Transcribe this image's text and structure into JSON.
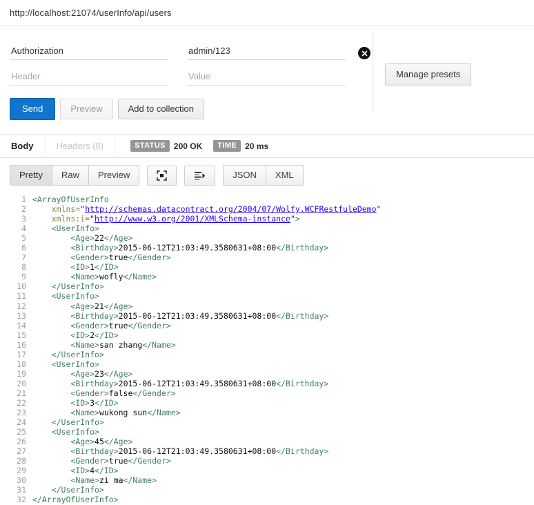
{
  "request": {
    "url": "http://localhost:21074/userInfo/api/users",
    "headers": [
      {
        "name_value": "Authorization",
        "name_placeholder": "Header",
        "value_value": "admin/123",
        "value_placeholder": "Value"
      },
      {
        "name_value": "",
        "name_placeholder": "Header",
        "value_value": "",
        "value_placeholder": "Value"
      }
    ],
    "clear_icon": "clear-circle-icon",
    "manage_presets_label": "Manage presets",
    "actions": {
      "send_label": "Send",
      "preview_label": "Preview",
      "add_to_collection_label": "Add to collection"
    }
  },
  "response": {
    "tabs": [
      {
        "label": "Body",
        "active": true
      },
      {
        "label": "Headers (8)",
        "active": false
      }
    ],
    "status_badge_label": "STATUS",
    "status_value": "200 OK",
    "time_badge_label": "TIME",
    "time_value": "20 ms",
    "view_modes": [
      {
        "label": "Pretty",
        "active": true
      },
      {
        "label": "Raw",
        "active": false
      },
      {
        "label": "Preview",
        "active": false
      }
    ],
    "icon_buttons": [
      {
        "icon": "fullscreen-icon"
      },
      {
        "icon": "format-indent-icon"
      }
    ],
    "content_types": [
      {
        "label": "JSON",
        "active": false
      },
      {
        "label": "XML",
        "active": false
      }
    ]
  },
  "code": {
    "language": "xml",
    "lines": [
      {
        "n": 1,
        "parts": [
          {
            "t": "tag",
            "s": "<ArrayOfUserInfo"
          }
        ]
      },
      {
        "n": 2,
        "parts": [
          {
            "t": "plain",
            "s": "    "
          },
          {
            "t": "attr",
            "s": "xmlns="
          },
          {
            "t": "str",
            "s": "\""
          },
          {
            "t": "lnk",
            "s": "http://schemas.datacontract.org/2004/07/Wolfy.WCFRestfuleDemo"
          },
          {
            "t": "str",
            "s": "\""
          }
        ]
      },
      {
        "n": 3,
        "parts": [
          {
            "t": "plain",
            "s": "    "
          },
          {
            "t": "attr",
            "s": "xmlns:i="
          },
          {
            "t": "str",
            "s": "\""
          },
          {
            "t": "lnk",
            "s": "http://www.w3.org/2001/XMLSchema-instance"
          },
          {
            "t": "str",
            "s": "\""
          },
          {
            "t": "tag",
            "s": ">"
          }
        ]
      },
      {
        "n": 4,
        "parts": [
          {
            "t": "plain",
            "s": "    "
          },
          {
            "t": "tag",
            "s": "<UserInfo>"
          }
        ]
      },
      {
        "n": 5,
        "parts": [
          {
            "t": "plain",
            "s": "        "
          },
          {
            "t": "tag",
            "s": "<Age>"
          },
          {
            "t": "txt",
            "s": "22"
          },
          {
            "t": "tag",
            "s": "</Age>"
          }
        ]
      },
      {
        "n": 6,
        "parts": [
          {
            "t": "plain",
            "s": "        "
          },
          {
            "t": "tag",
            "s": "<Birthday>"
          },
          {
            "t": "txt",
            "s": "2015-06-12T21:03:49.3580631+08:00"
          },
          {
            "t": "tag",
            "s": "</Birthday>"
          }
        ]
      },
      {
        "n": 7,
        "parts": [
          {
            "t": "plain",
            "s": "        "
          },
          {
            "t": "tag",
            "s": "<Gender>"
          },
          {
            "t": "txt",
            "s": "true"
          },
          {
            "t": "tag",
            "s": "</Gender>"
          }
        ]
      },
      {
        "n": 8,
        "parts": [
          {
            "t": "plain",
            "s": "        "
          },
          {
            "t": "tag",
            "s": "<ID>"
          },
          {
            "t": "txt",
            "s": "1"
          },
          {
            "t": "tag",
            "s": "</ID>"
          }
        ]
      },
      {
        "n": 9,
        "parts": [
          {
            "t": "plain",
            "s": "        "
          },
          {
            "t": "tag",
            "s": "<Name>"
          },
          {
            "t": "txt",
            "s": "wofly"
          },
          {
            "t": "tag",
            "s": "</Name>"
          }
        ]
      },
      {
        "n": 10,
        "parts": [
          {
            "t": "plain",
            "s": "    "
          },
          {
            "t": "tag",
            "s": "</UserInfo>"
          }
        ]
      },
      {
        "n": 11,
        "parts": [
          {
            "t": "plain",
            "s": "    "
          },
          {
            "t": "tag",
            "s": "<UserInfo>"
          }
        ]
      },
      {
        "n": 12,
        "parts": [
          {
            "t": "plain",
            "s": "        "
          },
          {
            "t": "tag",
            "s": "<Age>"
          },
          {
            "t": "txt",
            "s": "21"
          },
          {
            "t": "tag",
            "s": "</Age>"
          }
        ]
      },
      {
        "n": 13,
        "parts": [
          {
            "t": "plain",
            "s": "        "
          },
          {
            "t": "tag",
            "s": "<Birthday>"
          },
          {
            "t": "txt",
            "s": "2015-06-12T21:03:49.3580631+08:00"
          },
          {
            "t": "tag",
            "s": "</Birthday>"
          }
        ]
      },
      {
        "n": 14,
        "parts": [
          {
            "t": "plain",
            "s": "        "
          },
          {
            "t": "tag",
            "s": "<Gender>"
          },
          {
            "t": "txt",
            "s": "true"
          },
          {
            "t": "tag",
            "s": "</Gender>"
          }
        ]
      },
      {
        "n": 15,
        "parts": [
          {
            "t": "plain",
            "s": "        "
          },
          {
            "t": "tag",
            "s": "<ID>"
          },
          {
            "t": "txt",
            "s": "2"
          },
          {
            "t": "tag",
            "s": "</ID>"
          }
        ]
      },
      {
        "n": 16,
        "parts": [
          {
            "t": "plain",
            "s": "        "
          },
          {
            "t": "tag",
            "s": "<Name>"
          },
          {
            "t": "txt",
            "s": "san zhang"
          },
          {
            "t": "tag",
            "s": "</Name>"
          }
        ]
      },
      {
        "n": 17,
        "parts": [
          {
            "t": "plain",
            "s": "    "
          },
          {
            "t": "tag",
            "s": "</UserInfo>"
          }
        ]
      },
      {
        "n": 18,
        "parts": [
          {
            "t": "plain",
            "s": "    "
          },
          {
            "t": "tag",
            "s": "<UserInfo>"
          }
        ]
      },
      {
        "n": 19,
        "parts": [
          {
            "t": "plain",
            "s": "        "
          },
          {
            "t": "tag",
            "s": "<Age>"
          },
          {
            "t": "txt",
            "s": "23"
          },
          {
            "t": "tag",
            "s": "</Age>"
          }
        ]
      },
      {
        "n": 20,
        "parts": [
          {
            "t": "plain",
            "s": "        "
          },
          {
            "t": "tag",
            "s": "<Birthday>"
          },
          {
            "t": "txt",
            "s": "2015-06-12T21:03:49.3580631+08:00"
          },
          {
            "t": "tag",
            "s": "</Birthday>"
          }
        ]
      },
      {
        "n": 21,
        "parts": [
          {
            "t": "plain",
            "s": "        "
          },
          {
            "t": "tag",
            "s": "<Gender>"
          },
          {
            "t": "txt",
            "s": "false"
          },
          {
            "t": "tag",
            "s": "</Gender>"
          }
        ]
      },
      {
        "n": 22,
        "parts": [
          {
            "t": "plain",
            "s": "        "
          },
          {
            "t": "tag",
            "s": "<ID>"
          },
          {
            "t": "txt",
            "s": "3"
          },
          {
            "t": "tag",
            "s": "</ID>"
          }
        ]
      },
      {
        "n": 23,
        "parts": [
          {
            "t": "plain",
            "s": "        "
          },
          {
            "t": "tag",
            "s": "<Name>"
          },
          {
            "t": "txt",
            "s": "wukong sun"
          },
          {
            "t": "tag",
            "s": "</Name>"
          }
        ]
      },
      {
        "n": 24,
        "parts": [
          {
            "t": "plain",
            "s": "    "
          },
          {
            "t": "tag",
            "s": "</UserInfo>"
          }
        ]
      },
      {
        "n": 25,
        "parts": [
          {
            "t": "plain",
            "s": "    "
          },
          {
            "t": "tag",
            "s": "<UserInfo>"
          }
        ]
      },
      {
        "n": 26,
        "parts": [
          {
            "t": "plain",
            "s": "        "
          },
          {
            "t": "tag",
            "s": "<Age>"
          },
          {
            "t": "txt",
            "s": "45"
          },
          {
            "t": "tag",
            "s": "</Age>"
          }
        ]
      },
      {
        "n": 27,
        "parts": [
          {
            "t": "plain",
            "s": "        "
          },
          {
            "t": "tag",
            "s": "<Birthday>"
          },
          {
            "t": "txt",
            "s": "2015-06-12T21:03:49.3580631+08:00"
          },
          {
            "t": "tag",
            "s": "</Birthday>"
          }
        ]
      },
      {
        "n": 28,
        "parts": [
          {
            "t": "plain",
            "s": "        "
          },
          {
            "t": "tag",
            "s": "<Gender>"
          },
          {
            "t": "txt",
            "s": "true"
          },
          {
            "t": "tag",
            "s": "</Gender>"
          }
        ]
      },
      {
        "n": 29,
        "parts": [
          {
            "t": "plain",
            "s": "        "
          },
          {
            "t": "tag",
            "s": "<ID>"
          },
          {
            "t": "txt",
            "s": "4"
          },
          {
            "t": "tag",
            "s": "</ID>"
          }
        ]
      },
      {
        "n": 30,
        "parts": [
          {
            "t": "plain",
            "s": "        "
          },
          {
            "t": "tag",
            "s": "<Name>"
          },
          {
            "t": "txt",
            "s": "zi ma"
          },
          {
            "t": "tag",
            "s": "</Name>"
          }
        ]
      },
      {
        "n": 31,
        "parts": [
          {
            "t": "plain",
            "s": "    "
          },
          {
            "t": "tag",
            "s": "</UserInfo>"
          }
        ]
      },
      {
        "n": 32,
        "parts": [
          {
            "t": "tag",
            "s": "</ArrayOfUserInfo>"
          }
        ]
      }
    ]
  },
  "colors": {
    "send_blue": "#1175cc",
    "badge_gray": "#959595",
    "tag_green": "#3f7f5f",
    "attr_olive": "#7f7f3f",
    "link_blue": "#2a00ff"
  }
}
